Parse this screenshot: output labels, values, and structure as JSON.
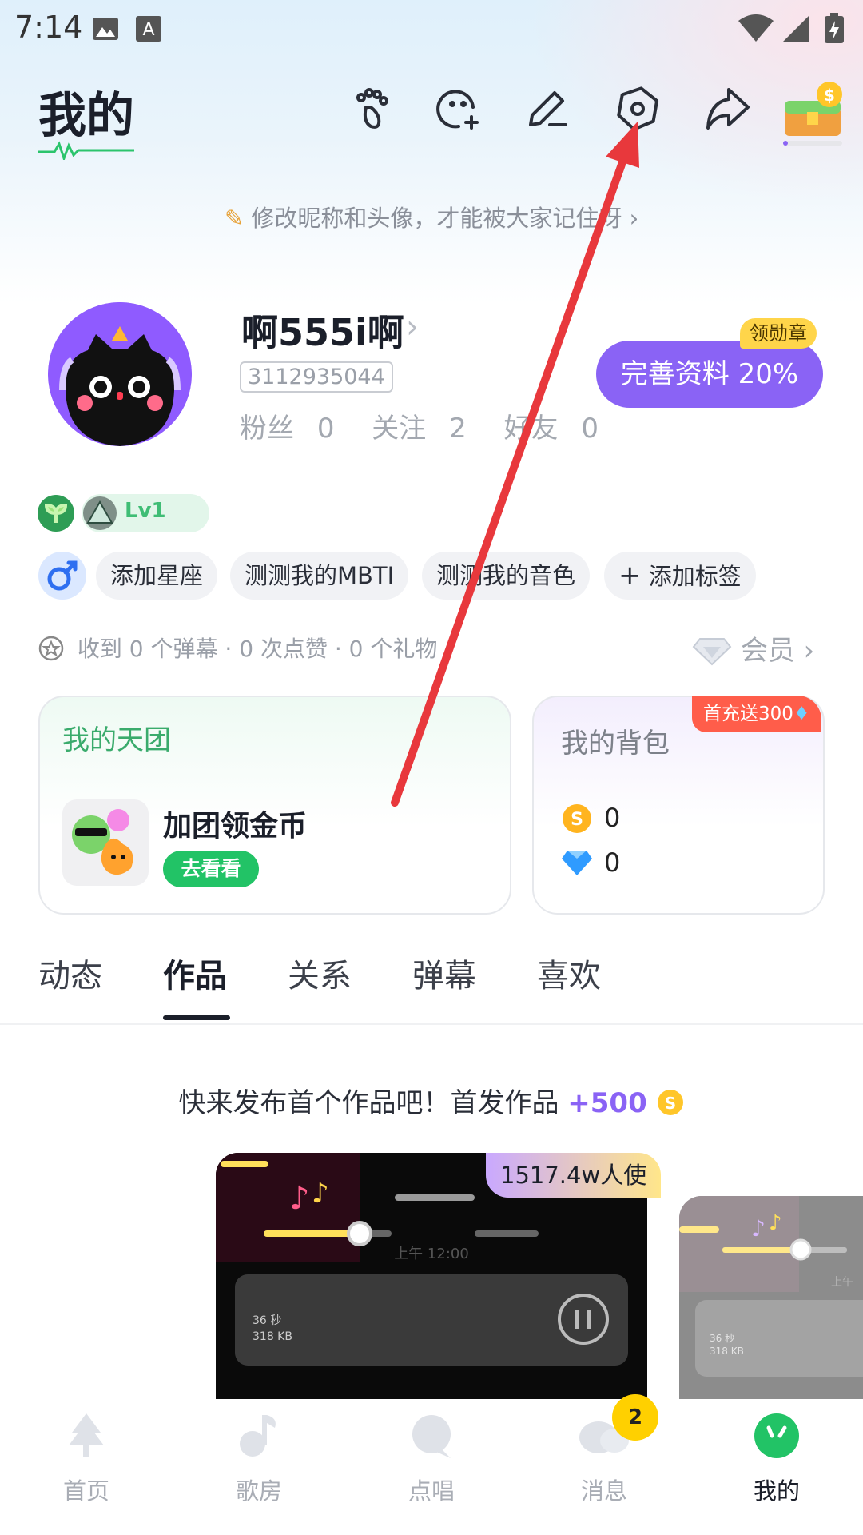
{
  "status_bar": {
    "time": "7:14"
  },
  "header": {
    "title": "我的",
    "icons": [
      "footprint-icon",
      "add-emoji-icon",
      "edit-icon",
      "settings-icon",
      "share-icon",
      "treasure-icon"
    ]
  },
  "nickname_tip": "修改昵称和头像，才能被大家记住呀",
  "profile": {
    "username": "啊555i啊",
    "uid": "3112935044",
    "fans_label": "粉丝",
    "fans": "0",
    "following_label": "关注",
    "following": "2",
    "friends_label": "好友",
    "friends": "0",
    "medal_badge": "领勋章",
    "complete_button": "完善资料 20%",
    "level": "Lv1"
  },
  "tags": [
    "添加星座",
    "测测我的MBTI",
    "测测我的音色",
    "添加标签"
  ],
  "tag_add_glyph": "+",
  "stats_line": "收到 0 个弹幕 · 0 次点赞 · 0 个礼物",
  "member_label": "会员",
  "team_card": {
    "title": "我的天团",
    "text": "加团领金币",
    "button": "去看看"
  },
  "bag_card": {
    "title": "我的背包",
    "promo": "首充送300",
    "coins": "0",
    "diamonds": "0"
  },
  "tabs": {
    "items": [
      "动态",
      "作品",
      "关系",
      "弹幕",
      "喜欢"
    ],
    "active_index": 1
  },
  "publish_prompt": {
    "text": "快来发布首个作品吧！首发作品",
    "bonus": "+500"
  },
  "preview": {
    "users_badge": "1517.4w人使",
    "time_text": "上午 12:00",
    "duration": "36 秒",
    "size": "318 KB",
    "side_time": "上午",
    "side_duration": "36 秒",
    "side_size": "318 KB"
  },
  "bottom_nav": {
    "items": [
      "首页",
      "歌房",
      "点唱",
      "消息",
      "我的"
    ],
    "active_index": 4,
    "message_badge": "2"
  },
  "colors": {
    "accent_purple": "#8a63f5",
    "accent_green": "#22c366",
    "medal_yellow": "#ffd54a",
    "promo_red": "#ff5d4a",
    "annotation_arrow": "#e8383c"
  }
}
